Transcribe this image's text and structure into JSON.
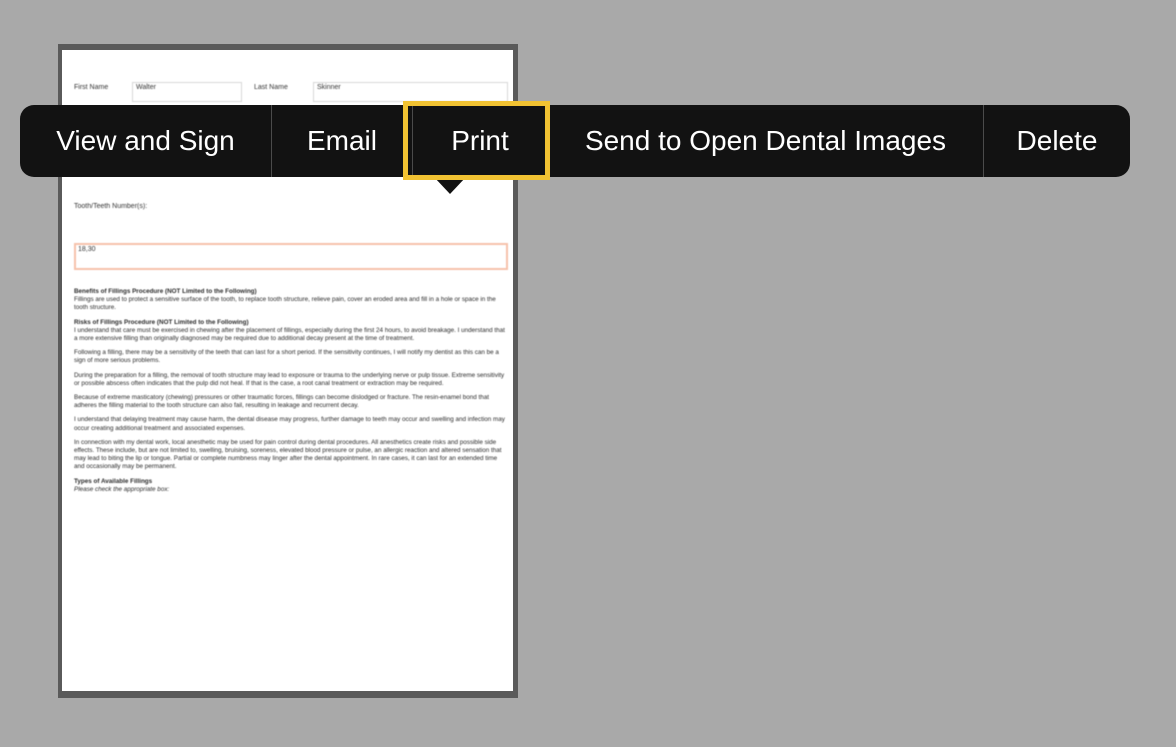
{
  "document": {
    "first_name_label": "First Name",
    "first_name_value": "Walter",
    "last_name_label": "Last Name",
    "last_name_value": "Skinner",
    "teeth_label": "Tooth/Teeth Number(s):",
    "teeth_value": "18,30",
    "benefits_heading": "Benefits of Fillings Procedure (NOT Limited to the Following)",
    "benefits_text": "Fillings are used to protect a sensitive surface of the tooth, to replace tooth structure, relieve pain, cover an eroded area and fill in a hole or space in the tooth structure.",
    "risks_heading": "Risks of Fillings Procedure (NOT Limited to the Following)",
    "risks_paragraphs": [
      "I understand that care must be exercised in chewing after the placement of fillings, especially during the first 24 hours, to avoid breakage. I understand that a more extensive filling than originally diagnosed may be required due to additional decay present at the time of treatment.",
      "Following a filling, there may be a sensitivity of the teeth that can last for a short period. If the sensitivity continues, I will notify my dentist as this can be a sign of more serious problems.",
      "During the preparation for a filling, the removal of tooth structure may lead to exposure or trauma to the underlying nerve or pulp tissue. Extreme sensitivity or possible abscess often indicates that the pulp did not heal. If that is the case, a root canal treatment or extraction may be required.",
      "Because of extreme masticatory (chewing) pressures or other traumatic forces, fillings can become dislodged or fracture. The resin-enamel bond that adheres the filling material to the tooth structure can also fail, resulting in leakage and recurrent decay.",
      "I understand that delaying treatment may cause harm, the dental disease may progress, further damage to teeth may occur and swelling and infection may occur creating additional treatment and associated expenses.",
      "In connection with my dental work, local anesthetic may be used for pain control during dental procedures. All anesthetics create risks and possible side effects. These include, but are not limited to, swelling, bruising, soreness, elevated blood pressure or pulse, an allergic reaction and altered sensation that may lead to biting the lip or tongue. Partial or complete numbness may linger after the dental appointment. In rare cases, it can last for an extended time and occasionally may be permanent."
    ],
    "types_heading": "Types of Available Fillings",
    "types_sub": "Please check the appropriate box:"
  },
  "menu": {
    "view_and_sign": "View and Sign",
    "email": "Email",
    "print": "Print",
    "send_to_images": "Send to Open Dental Images",
    "delete": "Delete"
  },
  "colors": {
    "highlight": "#f1c232",
    "menu_background": "#121212",
    "canvas_background": "#a9a9a9",
    "teeth_field_border": "#f6c2ab"
  }
}
